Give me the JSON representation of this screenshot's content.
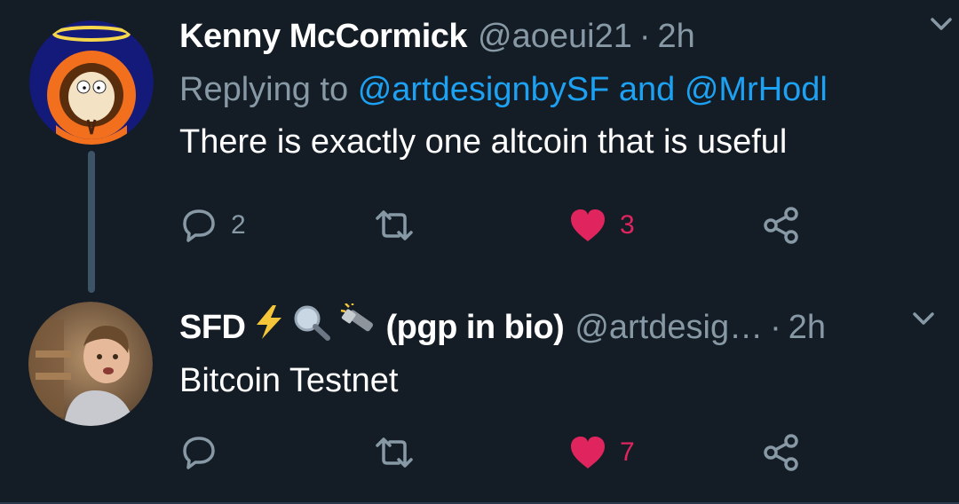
{
  "tweets": [
    {
      "author_name": "Kenny McCormick",
      "handle": "@aoeui21",
      "separator": "·",
      "time": "2h",
      "replying_prefix": "Replying to",
      "replying_mention_1": "@artdesignbySF",
      "replying_and": "and",
      "replying_mention_2": "@MrHodl",
      "text": "There is exactly one altcoin that is useful",
      "reply_count": "2",
      "retweet_count": "",
      "like_count": "3",
      "liked": true,
      "avatar_icon": "kenny-avatar-icon"
    },
    {
      "author_name": "SFD",
      "name_suffix": "(pgp in bio)",
      "name_emojis": [
        "lightning-icon",
        "magnifier-icon",
        "flashlight-icon"
      ],
      "handle": "@artdesig…",
      "separator": "·",
      "time": "2h",
      "text": "Bitcoin Testnet",
      "reply_count": "",
      "retweet_count": "",
      "like_count": "7",
      "liked": true,
      "avatar_icon": "child-photo-avatar"
    }
  ],
  "colors": {
    "background": "#141d26",
    "secondary_text": "#8899a6",
    "link": "#1da1f2",
    "like": "#e0245e",
    "thread_line": "#3d5466"
  }
}
